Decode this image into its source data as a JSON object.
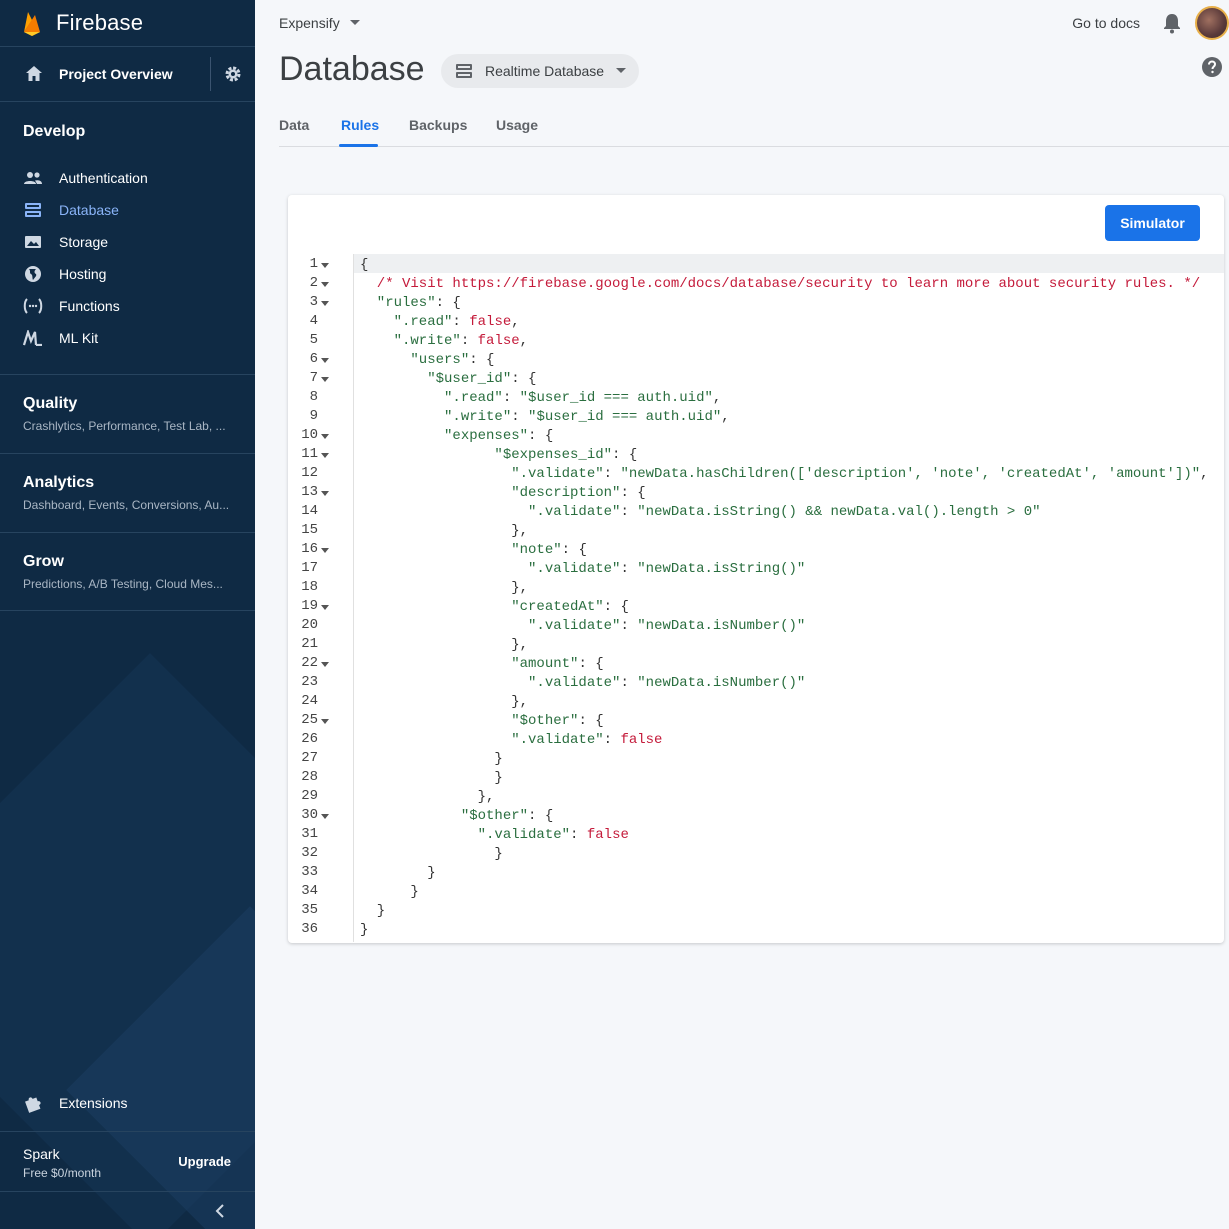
{
  "sidebar": {
    "brand": "Firebase",
    "project_overview": "Project Overview",
    "develop": {
      "title": "Develop",
      "items": [
        {
          "label": "Authentication",
          "icon": "people-icon"
        },
        {
          "label": "Database",
          "icon": "database-icon",
          "active": true
        },
        {
          "label": "Storage",
          "icon": "image-icon"
        },
        {
          "label": "Hosting",
          "icon": "globe-icon"
        },
        {
          "label": "Functions",
          "icon": "functions-icon"
        },
        {
          "label": "ML Kit",
          "icon": "ml-kit-icon"
        }
      ]
    },
    "groups": [
      {
        "title": "Quality",
        "subtitle": "Crashlytics, Performance, Test Lab, ..."
      },
      {
        "title": "Analytics",
        "subtitle": "Dashboard, Events, Conversions, Au..."
      },
      {
        "title": "Grow",
        "subtitle": "Predictions, A/B Testing, Cloud Mes..."
      }
    ],
    "extensions": "Extensions",
    "plan": {
      "name": "Spark",
      "price": "Free $0/month",
      "upgrade": "Upgrade"
    }
  },
  "topbar": {
    "project": "Expensify",
    "docs": "Go to docs"
  },
  "page": {
    "title": "Database",
    "db_selector": "Realtime Database",
    "tabs": [
      "Data",
      "Rules",
      "Backups",
      "Usage"
    ],
    "active_tab": "Rules"
  },
  "editor": {
    "simulator_button": "Simulator",
    "fold_lines": [
      1,
      2,
      3,
      6,
      7,
      10,
      11,
      13,
      16,
      19,
      22,
      25,
      30
    ],
    "lines": [
      [
        [
          "p",
          "{"
        ]
      ],
      [
        [
          "c",
          "  /* Visit https://firebase.google.com/docs/database/security to learn more about security rules. */"
        ]
      ],
      [
        [
          "s",
          "  \"rules\""
        ],
        [
          "p",
          ": {"
        ]
      ],
      [
        [
          "s",
          "    \".read\""
        ],
        [
          "p",
          ": "
        ],
        [
          "k",
          "false"
        ],
        [
          "p",
          ","
        ]
      ],
      [
        [
          "s",
          "    \".write\""
        ],
        [
          "p",
          ": "
        ],
        [
          "k",
          "false"
        ],
        [
          "p",
          ","
        ]
      ],
      [
        [
          "s",
          "      \"users\""
        ],
        [
          "p",
          ": {"
        ]
      ],
      [
        [
          "s",
          "        \"$user_id\""
        ],
        [
          "p",
          ": {"
        ]
      ],
      [
        [
          "s",
          "          \".read\""
        ],
        [
          "p",
          ": "
        ],
        [
          "s",
          "\"$user_id === auth.uid\""
        ],
        [
          "p",
          ","
        ]
      ],
      [
        [
          "s",
          "          \".write\""
        ],
        [
          "p",
          ": "
        ],
        [
          "s",
          "\"$user_id === auth.uid\""
        ],
        [
          "p",
          ","
        ]
      ],
      [
        [
          "s",
          "          \"expenses\""
        ],
        [
          "p",
          ": {"
        ]
      ],
      [
        [
          "s",
          "                \"$expenses_id\""
        ],
        [
          "p",
          ": {"
        ]
      ],
      [
        [
          "s",
          "                  \".validate\""
        ],
        [
          "p",
          ": "
        ],
        [
          "s",
          "\"newData.hasChildren(['description', 'note', 'createdAt', 'amount'])\""
        ],
        [
          "p",
          ","
        ]
      ],
      [
        [
          "s",
          "                  \"description\""
        ],
        [
          "p",
          ": {"
        ]
      ],
      [
        [
          "s",
          "                    \".validate\""
        ],
        [
          "p",
          ": "
        ],
        [
          "s",
          "\"newData.isString() && newData.val().length > 0\""
        ]
      ],
      [
        [
          "p",
          "                  },"
        ]
      ],
      [
        [
          "s",
          "                  \"note\""
        ],
        [
          "p",
          ": {"
        ]
      ],
      [
        [
          "s",
          "                    \".validate\""
        ],
        [
          "p",
          ": "
        ],
        [
          "s",
          "\"newData.isString()\""
        ]
      ],
      [
        [
          "p",
          "                  },"
        ]
      ],
      [
        [
          "s",
          "                  \"createdAt\""
        ],
        [
          "p",
          ": {"
        ]
      ],
      [
        [
          "s",
          "                    \".validate\""
        ],
        [
          "p",
          ": "
        ],
        [
          "s",
          "\"newData.isNumber()\""
        ]
      ],
      [
        [
          "p",
          "                  },"
        ]
      ],
      [
        [
          "s",
          "                  \"amount\""
        ],
        [
          "p",
          ": {"
        ]
      ],
      [
        [
          "s",
          "                    \".validate\""
        ],
        [
          "p",
          ": "
        ],
        [
          "s",
          "\"newData.isNumber()\""
        ]
      ],
      [
        [
          "p",
          "                  },"
        ]
      ],
      [
        [
          "s",
          "                  \"$other\""
        ],
        [
          "p",
          ": {"
        ]
      ],
      [
        [
          "s",
          "                  \".validate\""
        ],
        [
          "p",
          ": "
        ],
        [
          "k",
          "false"
        ]
      ],
      [
        [
          "p",
          "                }"
        ]
      ],
      [
        [
          "p",
          "                }"
        ]
      ],
      [
        [
          "p",
          "              },"
        ]
      ],
      [
        [
          "s",
          "            \"$other\""
        ],
        [
          "p",
          ": {"
        ]
      ],
      [
        [
          "s",
          "              \".validate\""
        ],
        [
          "p",
          ": "
        ],
        [
          "k",
          "false"
        ]
      ],
      [
        [
          "p",
          "                }"
        ]
      ],
      [
        [
          "p",
          "        }"
        ]
      ],
      [
        [
          "p",
          "      }"
        ]
      ],
      [
        [
          "p",
          "  }"
        ]
      ],
      [
        [
          "p",
          "}"
        ]
      ]
    ]
  },
  "colors": {
    "sidebar_bg": "#0f2a44",
    "accent": "#1a73e8",
    "string": "#2a6e3f",
    "keyword": "#c41a3a"
  }
}
